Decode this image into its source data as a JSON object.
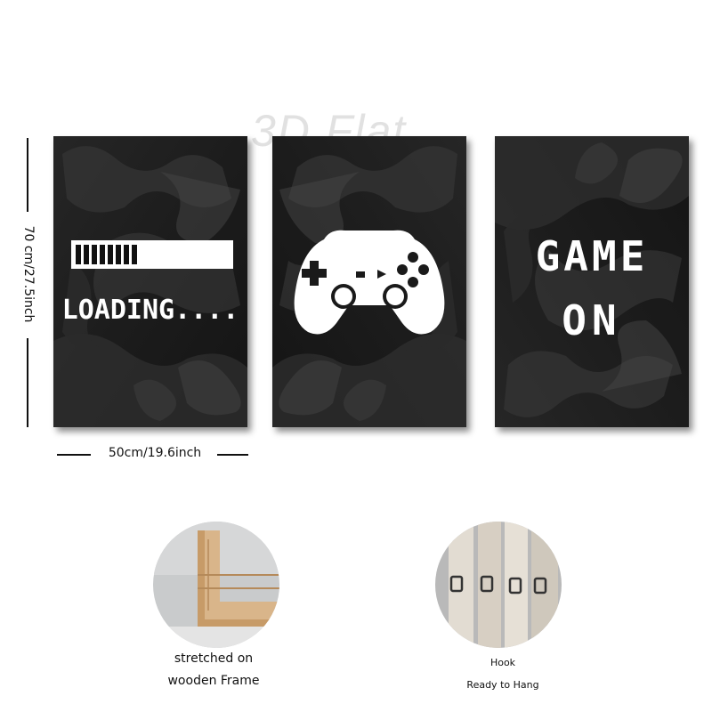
{
  "watermark": "3D Flat",
  "panels": {
    "loading": {
      "text": "LOADING....",
      "progress_fraction": 0.42
    },
    "controller": {
      "icon": "gamepad-icon"
    },
    "game_on": {
      "line1": "GAME",
      "line2": "ON"
    }
  },
  "dimensions": {
    "height_label": "70 cm/27.5inch",
    "width_label": "50cm/19.6inch"
  },
  "details": {
    "frame": {
      "line1": "stretched on",
      "line2": "wooden Frame"
    },
    "hook": {
      "line1": "Hook",
      "line2": "Ready to Hang"
    }
  },
  "colors": {
    "panel_dark": "#1a1a1a",
    "panel_mid": "#3c3c3c",
    "print_white": "#ffffff"
  }
}
